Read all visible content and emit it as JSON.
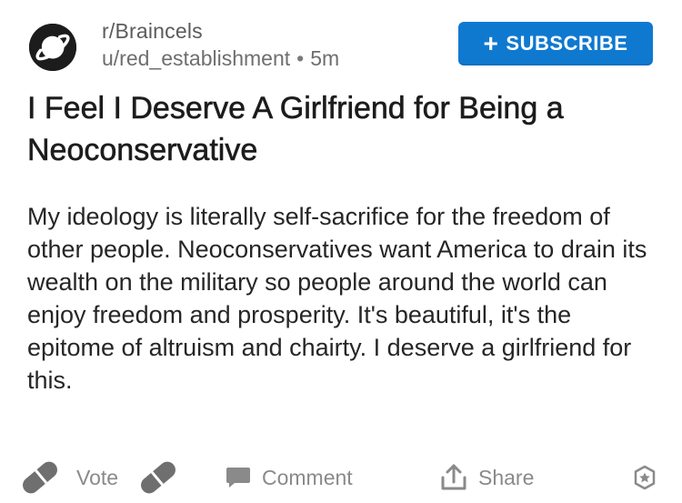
{
  "header": {
    "subreddit": "r/Braincels",
    "author": "u/red_establishment",
    "separator": "•",
    "time": "5m",
    "subscribe_label": "SUBSCRIBE",
    "subscribe_plus": "+"
  },
  "post": {
    "title": "I Feel I Deserve A Girlfriend for Being a Neoconservative",
    "body": "My ideology is literally self-sacrifice for the freedom of other people. Neoconservatives want America to drain its wealth on the military so people around the world can enjoy freedom and prosperity. It's beautiful, it's the epitome of altruism and chairty. I deserve a girlfriend for this."
  },
  "actions": {
    "vote_label": "Vote",
    "comment_label": "Comment",
    "share_label": "Share"
  },
  "icons": {
    "subreddit_avatar": "planet-icon",
    "upvote": "upvote-icon",
    "downvote": "downvote-icon",
    "comment": "comment-icon",
    "share": "share-icon",
    "award": "award-icon"
  },
  "colors": {
    "subscribe_bg": "#0f79d0",
    "muted_text": "#8a8a8a",
    "title_text": "#1c1c1c"
  }
}
